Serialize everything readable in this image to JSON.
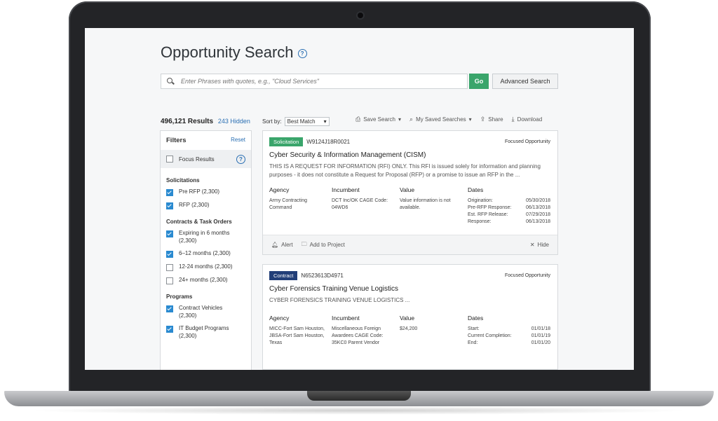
{
  "page": {
    "title": "Opportunity Search"
  },
  "search": {
    "placeholder": "Enter Phrases with quotes, e.g., \"Cloud Services\"",
    "go_label": "Go",
    "advanced_label": "Advanced Search"
  },
  "results": {
    "count": "496,121 Results",
    "hidden": "243 Hidden"
  },
  "sort": {
    "label": "Sort by:",
    "value": "Best Match"
  },
  "toolbar": {
    "save_search": "Save Search",
    "my_saved": "My Saved Searches",
    "share": "Share",
    "download": "Download"
  },
  "filters": {
    "title": "Filters",
    "reset": "Reset",
    "focus": "Focus Results",
    "sections": [
      {
        "title": "Solicitations",
        "items": [
          {
            "label": "Pre RFP (2,300)",
            "checked": true
          },
          {
            "label": "RFP (2,300)",
            "checked": true
          }
        ]
      },
      {
        "title": "Contracts & Task Orders",
        "items": [
          {
            "label": "Expiring in 6 months (2,300)",
            "checked": true
          },
          {
            "label": "6–12 months (2,300)",
            "checked": true
          },
          {
            "label": "12-24 months (2,300)",
            "checked": false
          },
          {
            "label": "24+ months (2,300)",
            "checked": false
          }
        ]
      },
      {
        "title": "Programs",
        "items": [
          {
            "label": "Contract Vehicles (2,300)",
            "checked": true
          },
          {
            "label": "IT Budget Programs (2,300)",
            "checked": true
          }
        ]
      }
    ]
  },
  "cards": [
    {
      "badge": "Solicitation",
      "id": "W9124J18R0021",
      "focused": "Focused Opportunity",
      "title": "Cyber Security & Information Management (CISM)",
      "desc": "THIS IS A REQUEST FOR INFORMATION (RFI) ONLY. This RFI is issued solely for information and planning purposes - it does not constitute a Request for Proposal (RFP) or a promise to issue an RFP in the ...",
      "agency_h": "Agency",
      "agency": "Army Contracting Command",
      "incumbent_h": "Incumbent",
      "incumbent": "DCT Inc/OK CAGE Code: 04WD6",
      "value_h": "Value",
      "value": "Value information is not available.",
      "dates_h": "Dates",
      "dates": [
        {
          "k": "Origination:",
          "v": "05/30/2018"
        },
        {
          "k": "Pre-RFP Response:",
          "v": "06/13/2018"
        },
        {
          "k": "Est. RFP Release:",
          "v": "07/29/2018"
        },
        {
          "k": "Response:",
          "v": "06/13/2018"
        }
      ],
      "alert": "Alert",
      "add": "Add to Project",
      "hide": "Hide"
    },
    {
      "badge": "Contract",
      "id": "N6523613D4971",
      "focused": "Focused Opportunity",
      "title": "Cyber Forensics Training Venue Logistics",
      "desc": "CYBER FORENSICS TRAINING VENUE LOGISTICS ...",
      "agency_h": "Agency",
      "agency": "MICC-Fort Sam Houston, JBSA-Fort Sam Houston, Texas",
      "incumbent_h": "Incumbent",
      "incumbent": "Miscellaneous Foreign Awardees CAGE Code: 35KC0 Parent Vendor",
      "value_h": "Value",
      "value": "$24,200",
      "dates_h": "Dates",
      "dates": [
        {
          "k": "Start:",
          "v": "01/01/18"
        },
        {
          "k": "Current Completion:",
          "v": "01/01/19"
        },
        {
          "k": "End:",
          "v": "01/01/20"
        }
      ]
    }
  ]
}
